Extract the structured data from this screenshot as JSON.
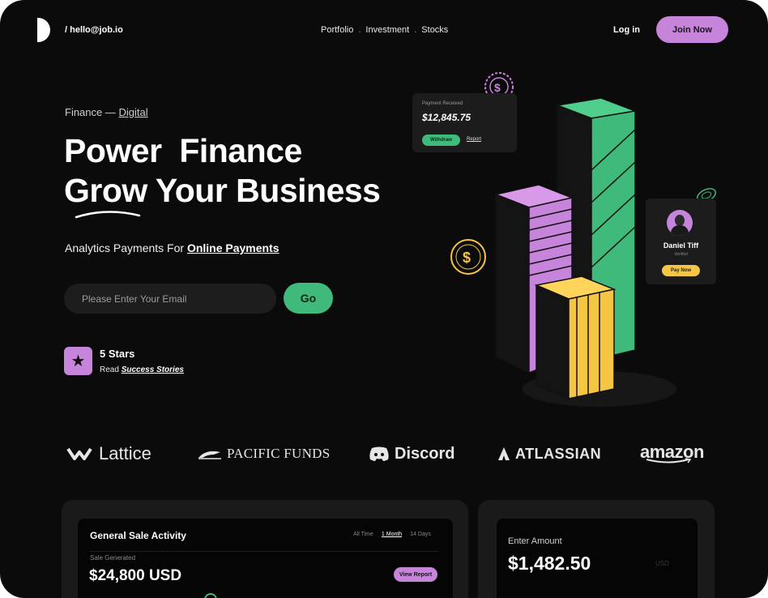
{
  "header": {
    "email": "/ hello@job.io",
    "nav": [
      "Portfolio",
      ".",
      "Investment",
      ".",
      "Stocks"
    ],
    "login": "Log in",
    "join": "Join Now"
  },
  "hero": {
    "eyebrow_prefix": "Finance —",
    "eyebrow_link": "Digital",
    "title_line1": "Power  Finance",
    "title_line2": "Grow Your Business",
    "subtitle_prefix": "Analytics Payments For",
    "subtitle_link": "Online Payments",
    "email_placeholder": "Please Enter Your Email",
    "go": "Go",
    "stars_title": "5 Stars",
    "stars_prefix": "Read",
    "stars_link": "Success Stories"
  },
  "payment_card": {
    "label": "Payment Received",
    "amount": "$12,845.75",
    "withdraw": "Withdraw",
    "report": "Report"
  },
  "profile_card": {
    "name": "Daniel Tiff",
    "status": "Verified",
    "button": "Pay Now"
  },
  "logos": {
    "lattice": "Lattice",
    "pacific": "PACIFIC FUNDS",
    "discord": "Discord",
    "atlassian": "ATLASSIAN",
    "amazon": "amazon"
  },
  "sales": {
    "title": "General Sale Activity",
    "filters": [
      "All Time",
      "1 Month",
      "14 Days"
    ],
    "active_filter": "1 Month",
    "label": "Sale Generated",
    "amount": "$24,800 USD",
    "button": "View Report"
  },
  "amount_panel": {
    "label": "Enter Amount",
    "amount": "$1,482.50",
    "currency": "USD"
  },
  "colors": {
    "background": "#0b0b0b",
    "purple": "#c684da",
    "green": "#3fba7a",
    "yellow": "#f6c544"
  }
}
